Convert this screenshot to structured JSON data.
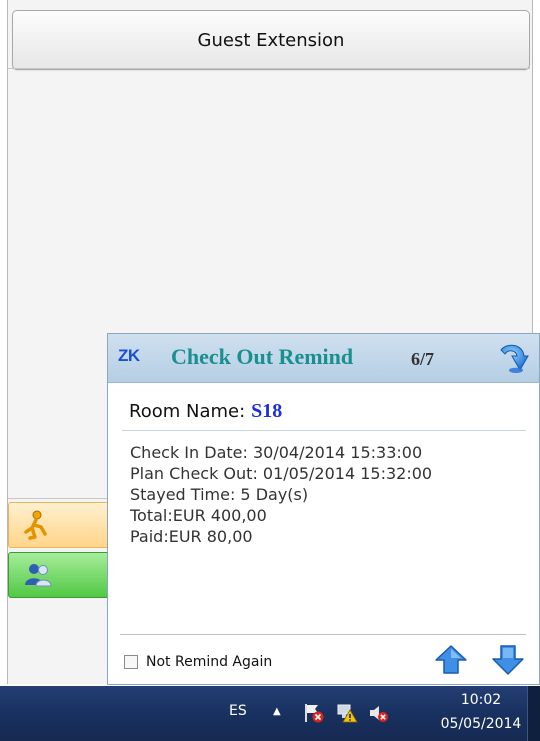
{
  "app": {
    "guest_extension_label": "Guest Extension"
  },
  "popup": {
    "logo": "ZK",
    "title": "Check Out Remind",
    "counter": "6/7",
    "room_label": "Room Name:",
    "room_value": "S18",
    "details": [
      "Check In Date: 30/04/2014 15:33:00",
      "Plan Check Out: 01/05/2014 15:32:00",
      "Stayed Time: 5 Day(s)",
      "Total:EUR 400,00",
      "Paid:EUR 80,00"
    ],
    "not_remind_label": "Not Remind Again",
    "not_remind_checked": false
  },
  "taskbar": {
    "language": "ES",
    "tray_icons": [
      "show-hidden-icons-arrow",
      "action-center-flag-icon",
      "network-warning-icon",
      "volume-muted-icon"
    ],
    "time": "10:02",
    "date": "05/05/2014"
  },
  "colors": {
    "popup_title": "#1a8f8f",
    "room_value": "#1a2ee0",
    "taskbar": "#1c3566"
  }
}
